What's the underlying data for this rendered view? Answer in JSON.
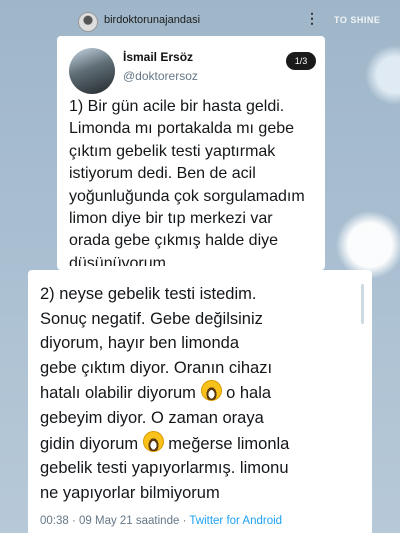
{
  "topbar": {
    "username": "birdoktorunajandasi",
    "more_icon": "⋮",
    "brand": "TO SHINE"
  },
  "tweet1": {
    "display_name": "İsmail Ersöz",
    "handle": "@doktorersoz",
    "pager": "1/3",
    "text": "1) Bir gün acile bir hasta geldi.\nLimonda mı portakalda mı gebe\nçıktım gebelik testi yaptırmak\nistiyorum dedi. Ben de acil\nyoğunluğunda çok sorgulamadım\nlimon diye bir tıp merkezi var\norada gebe çıkmış halde diye\ndüşünüyorum"
  },
  "tweet2": {
    "line1": "2) neyse gebelik testi istedim.",
    "line2": "Sonuç negatif. Gebe değilsiniz",
    "line3": "diyorum, hayır ben limonda",
    "line4": "gebe çıktım diyor. Oranın cihazı",
    "line5_a": "hatalı olabilir diyorum ",
    "line5_b": " o hala",
    "line6": "gebeyim diyor. O zaman oraya",
    "line7_a": "gidin diyorum ",
    "line7_b": " meğerse limonla",
    "line8": "gebelik testi yapıyorlarmış. limonu",
    "line9": "ne yapıyorlar bilmiyorum",
    "timestamp": "00:38 · 09 May 21 saatinde · ",
    "source": "Twitter for Android",
    "emoji_icon": "grinning-face-icon"
  }
}
